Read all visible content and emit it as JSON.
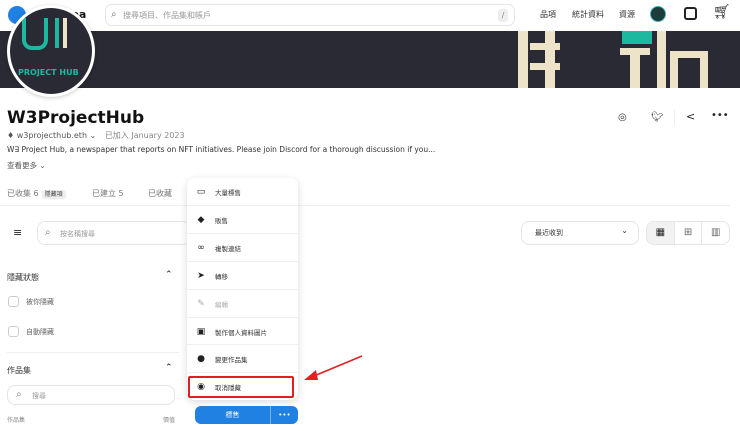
{
  "header": {
    "brand": "OpenSea",
    "search_placeholder": "搜尋項目、作品集和帳戶",
    "search_shortcut": "/",
    "nav": [
      "品項",
      "統計資料",
      "資源"
    ]
  },
  "profile": {
    "avatar_text": "PROJECT HUB",
    "name": "W3ProjectHub",
    "wallet": "w3projecthub.eth",
    "joined": "已加入 January 2023",
    "description": "W∃ Project Hub, a newspaper that reports on NFT initiatives. Please join Discord for a thorough discussion if you...",
    "see_more": "查看更多"
  },
  "tabs": [
    {
      "label": "已收集",
      "count": "6",
      "badge": "隱藏項"
    },
    {
      "label": "已建立",
      "count": "5"
    },
    {
      "label": "已收藏"
    }
  ],
  "filter": {
    "search_placeholder": "按名稱搜尋",
    "sort": "最近收到"
  },
  "sidebar": {
    "hidden_title": "隱藏狀態",
    "hidden_options": [
      "被你隱藏",
      "自動隱藏"
    ],
    "collection_title": "作品集",
    "collection_search_placeholder": "搜尋",
    "col_header_left": "作品集",
    "col_header_right": "價值"
  },
  "menu": {
    "items": [
      {
        "icon": "bulk-list-icon",
        "label": "大量標售"
      },
      {
        "icon": "tag-icon",
        "label": "販售"
      },
      {
        "icon": "link-icon",
        "label": "複製連結"
      },
      {
        "icon": "send-icon",
        "label": "轉移"
      },
      {
        "icon": "pencil-icon",
        "label": "編輯",
        "disabled": true
      },
      {
        "icon": "image-icon",
        "label": "製作個人資料圖片"
      },
      {
        "icon": "globe-icon",
        "label": "變更作品集"
      },
      {
        "icon": "eye-icon",
        "label": "取消隱藏",
        "highlighted": true
      }
    ]
  },
  "sell_button": {
    "label": "標售",
    "more": "•••"
  },
  "colors": {
    "accent": "#2081e2",
    "highlight": "#e02020",
    "banner": "#2a2a35"
  }
}
